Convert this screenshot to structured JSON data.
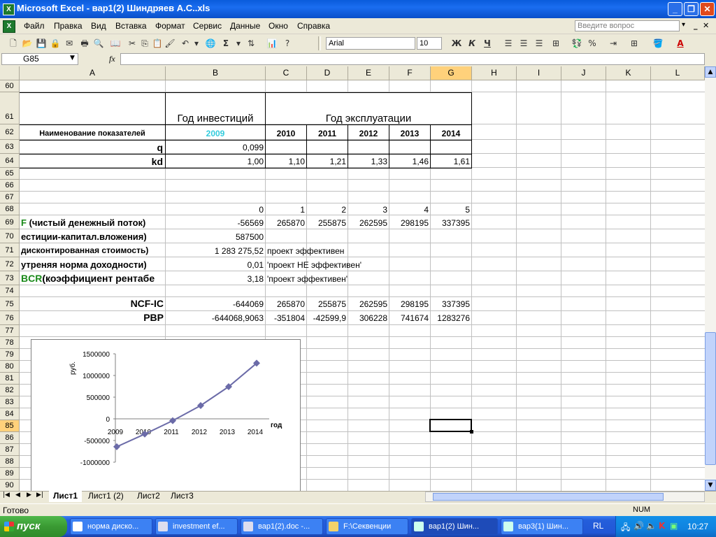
{
  "window": {
    "title": "Microsoft Excel - вар1(2) Шиндряев А.С..xls"
  },
  "menu": {
    "items": [
      "Файл",
      "Правка",
      "Вид",
      "Вставка",
      "Формат",
      "Сервис",
      "Данные",
      "Окно",
      "Справка"
    ],
    "help_placeholder": "Введите вопрос"
  },
  "toolbar": {
    "font": "Arial",
    "size": "10",
    "bold": "Ж",
    "italic": "К",
    "underline": "Ч"
  },
  "formula_bar": {
    "name_box": "G85",
    "fx": "fx",
    "content": ""
  },
  "grid": {
    "columns": [
      "A",
      "B",
      "C",
      "D",
      "E",
      "F",
      "G",
      "H",
      "I",
      "J",
      "K",
      "L"
    ],
    "selected_column": "G",
    "selected_row": "85",
    "rows": [
      "60",
      "61",
      "62",
      "63",
      "64",
      "65",
      "66",
      "67",
      "68",
      "69",
      "70",
      "71",
      "72",
      "73",
      "74",
      "75",
      "76",
      "77",
      "78",
      "79",
      "80",
      "81",
      "82",
      "83",
      "84",
      "85",
      "86",
      "87",
      "88",
      "89",
      "90"
    ]
  },
  "sheet": {
    "investment_year_header": "Год инвестиций",
    "operation_year_header": "Год эксплуатации",
    "indicator_header": "Наименование показателей",
    "years": [
      "2009",
      "2010",
      "2011",
      "2012",
      "2013",
      "2014"
    ],
    "q_label": "q",
    "q_value": "0,099",
    "kd_label": "kd",
    "kd_values": [
      "1,00",
      "1,10",
      "1,21",
      "1,33",
      "1,46",
      "1,61"
    ],
    "period_values": [
      "0",
      "1",
      "2",
      "3",
      "4",
      "5"
    ],
    "ncf_label_prefix": "F",
    "ncf_label": " (чистый денежный поток)",
    "ncf_values": [
      "-56569",
      "265870",
      "255875",
      "262595",
      "298195",
      "337395"
    ],
    "ic_label": "естиции-капитал.вложения)",
    "ic_value": "587500",
    "npv_label": "дисконтированная стоимость)",
    "npv_value": "1 283 275,52",
    "npv_text": "проект эффективен",
    "irr_label": "утреняя норма доходности)",
    "irr_value": "0,01",
    "irr_text": "'проект НЕ эффективен'",
    "bcr_label_prefix": "BCR",
    "bcr_label": "(коэффициент рентабе",
    "bcr_value": "3,18",
    "bcr_text": "'проект эффективен'",
    "ncfic_label": "NCF-IC",
    "ncfic_values": [
      "-644069",
      "265870",
      "255875",
      "262595",
      "298195",
      "337395"
    ],
    "pbp_label": "PBP",
    "pbp_values": [
      "-644068,9063",
      "-351804",
      "-42599,9",
      "306228",
      "741674",
      "1283276"
    ]
  },
  "chart_data": {
    "type": "line",
    "title": "",
    "xlabel": "год",
    "ylabel": "руб.",
    "categories": [
      "2009",
      "2010",
      "2011",
      "2012",
      "2013",
      "2014"
    ],
    "series": [
      {
        "values": [
          -644069,
          -351804,
          -42600,
          306228,
          741674,
          1283276
        ]
      }
    ],
    "ylim": [
      -1000000,
      1500000
    ],
    "yticks": [
      "1500000",
      "1000000",
      "500000",
      "0",
      "-500000",
      "-1000000"
    ],
    "grid": false,
    "line_color": "#6b6ba8"
  },
  "tabs": {
    "items": [
      "Лист1",
      "Лист1 (2)",
      "Лист2",
      "Лист3"
    ],
    "active": "Лист1"
  },
  "status": {
    "left": "Готово",
    "num": "NUM"
  },
  "taskbar": {
    "start": "пуск",
    "items": [
      "норма диско...",
      "investment ef...",
      "вар1(2).doc -...",
      "F:\\Секвенции",
      "вар1(2) Шин...",
      "вар3(1) Шин..."
    ],
    "lang": "RL",
    "clock": "10:27"
  }
}
